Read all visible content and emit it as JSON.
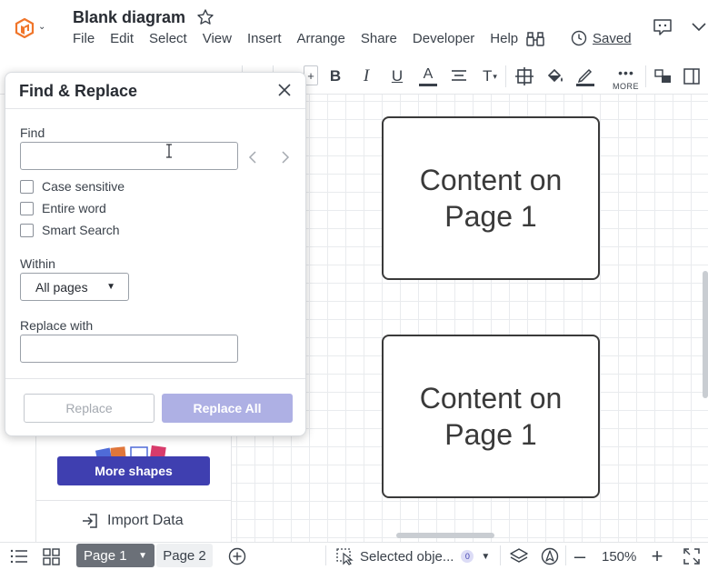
{
  "header": {
    "title": "Blank diagram",
    "menu": [
      "File",
      "Edit",
      "Select",
      "View",
      "Insert",
      "Arrange",
      "Share",
      "Developer",
      "Help"
    ],
    "saved_label": "Saved"
  },
  "toolbar": {
    "more_label": "MORE",
    "text_color": "#3a414a",
    "line_color": "#3a414a"
  },
  "canvas": {
    "shapes": [
      {
        "text_line1": "Content on",
        "text_line2": "Page 1"
      },
      {
        "text_line1": "Content on",
        "text_line2": "Page 1"
      }
    ]
  },
  "left_panel": {
    "more_shapes_label": "More shapes",
    "import_data_label": "Import Data"
  },
  "footer": {
    "pages": [
      {
        "label": "Page 1",
        "active": true
      },
      {
        "label": "Page 2",
        "active": false
      }
    ],
    "selected_label": "Selected obje...",
    "selected_count": "0",
    "zoom": "150%"
  },
  "dialog": {
    "title": "Find & Replace",
    "find_label": "Find",
    "find_value": "",
    "options": [
      {
        "label": "Case sensitive",
        "checked": false
      },
      {
        "label": "Entire word",
        "checked": false
      },
      {
        "label": "Smart Search",
        "checked": false
      }
    ],
    "within_label": "Within",
    "within_value": "All pages",
    "replace_with_label": "Replace with",
    "replace_value": "",
    "replace_button": "Replace",
    "replace_all_button": "Replace All"
  },
  "colors": {
    "accent": "#3f3fb0",
    "replace_all_disabled": "#aeb0e4",
    "logo_orange": "#f0752a"
  }
}
